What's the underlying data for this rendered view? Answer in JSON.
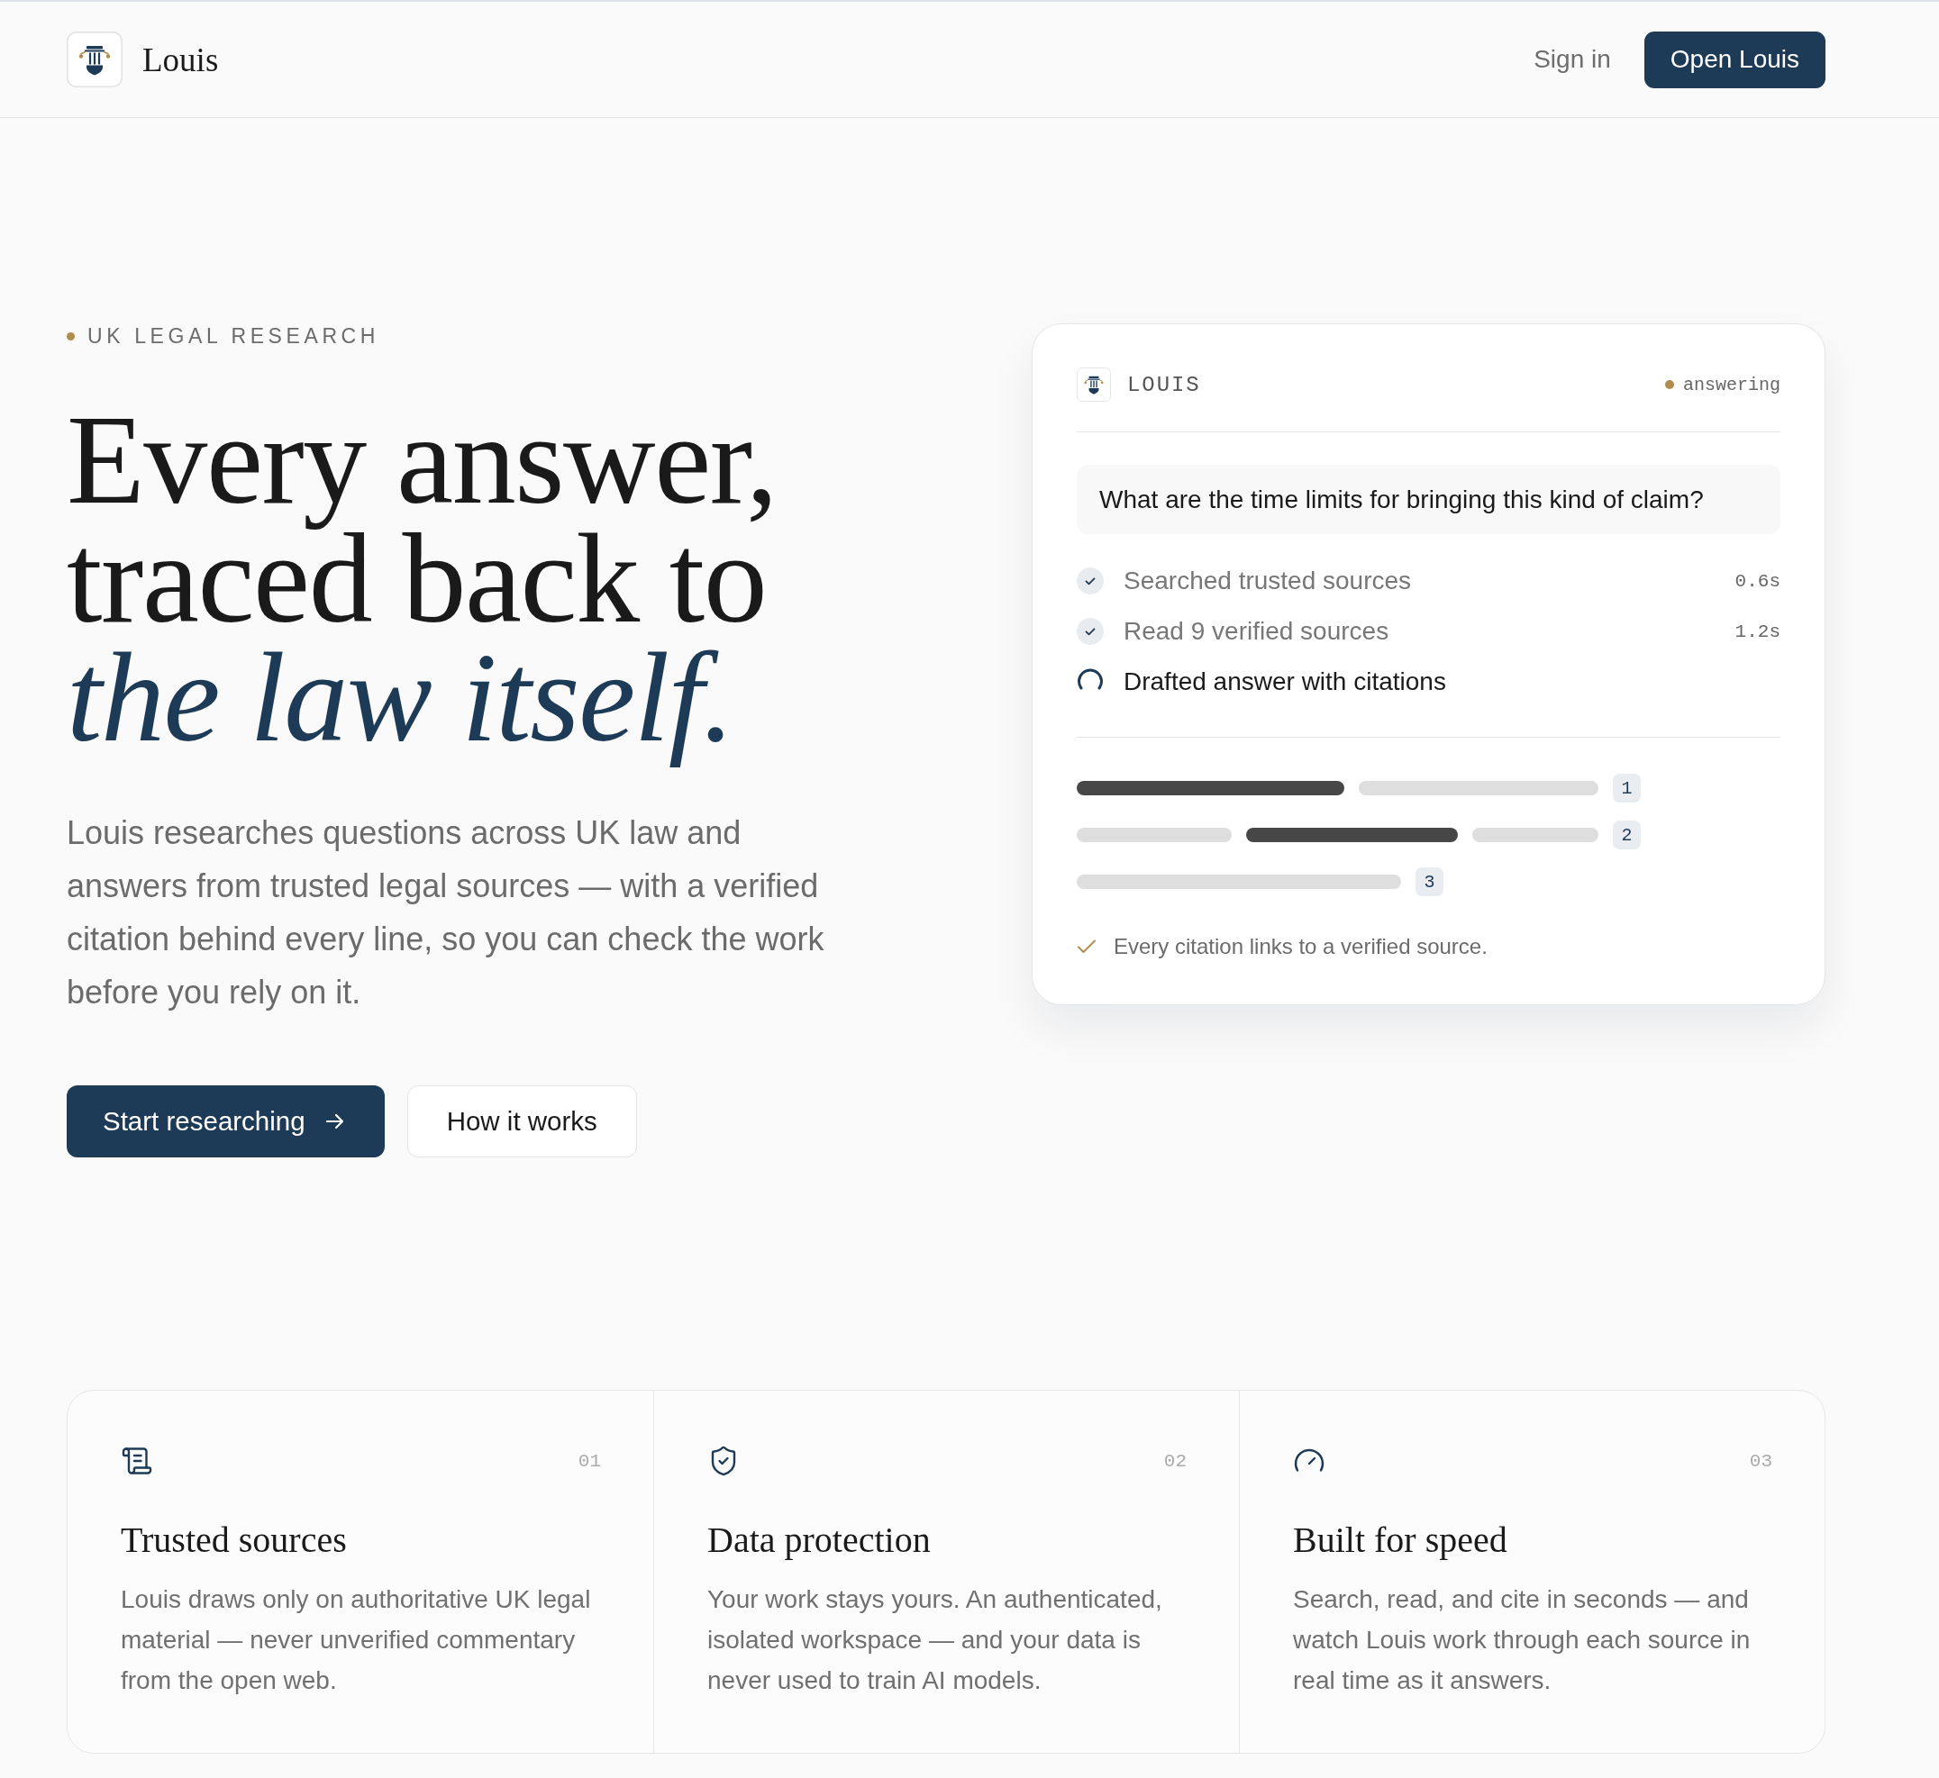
{
  "header": {
    "brand": "Louis",
    "actions": [
      {
        "label": "Sign in",
        "kind": "link"
      },
      {
        "label": "Open Louis",
        "kind": "primary"
      }
    ]
  },
  "hero": {
    "eyebrow": "UK LEGAL RESEARCH",
    "headline_lines": [
      "Every answer,",
      "traced back to",
      "*the law itself.*"
    ],
    "description": "Louis researches questions across UK law and answers from trusted legal sources — with a verified citation behind every line, so you can check the work before you rely on it.",
    "actions": [
      {
        "label": "Start researching",
        "kind": "primary"
      },
      {
        "label": "How it works",
        "kind": "secondary"
      }
    ]
  },
  "demo_card": {
    "title": "LOUIS",
    "status": "answering",
    "question": "What are the time limits for bringing this kind of claim?",
    "steps": [
      {
        "label": "Searched trusted sources",
        "time": "0.6s",
        "done": true
      },
      {
        "label": "Read 9 verified sources",
        "time": "1.2s",
        "done": true
      },
      {
        "label": "Drafted answer with citations",
        "done": false
      }
    ],
    "citations": [
      {
        "number": "1",
        "segments": [
          {
            "highlighted": true
          },
          {
            "highlighted": false
          }
        ]
      },
      {
        "number": "2",
        "segments": [
          {
            "highlighted": false
          },
          {
            "highlighted": true
          },
          {
            "highlighted": false
          }
        ]
      },
      {
        "number": "3",
        "segments": [
          {
            "highlighted": false
          }
        ]
      }
    ],
    "note": "Every citation links to a verified source."
  },
  "features": [
    {
      "number": "01",
      "title": "Trusted sources",
      "description": "Louis draws only on authoritative UK legal material — never unverified commentary from the open web."
    },
    {
      "number": "02",
      "title": "Data protection",
      "description": "Your work stays yours. An authenticated, isolated workspace — and your data is never used to train AI models."
    },
    {
      "number": "03",
      "title": "Built for speed",
      "description": "Search, read, and cite in seconds — and watch Louis work through each source in real time as it answers."
    }
  ]
}
